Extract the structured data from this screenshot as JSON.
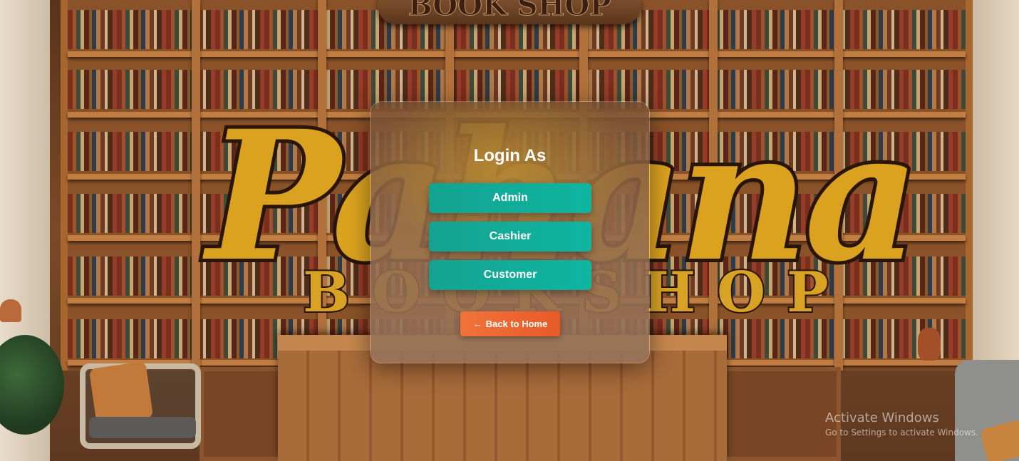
{
  "background": {
    "sign_text": "BOOK SHOP",
    "logo_word": "Pahana",
    "logo_sub": "BOOKSHOP"
  },
  "login": {
    "title": "Login As",
    "roles": [
      "Admin",
      "Cashier",
      "Customer"
    ],
    "back_label": "Back to Home",
    "back_icon": "arrow-left-icon"
  },
  "watermark": {
    "title": "Activate Windows",
    "subtitle": "Go to Settings to activate Windows."
  },
  "colors": {
    "role_button": "#0fb5a0",
    "back_button": "#e85a28",
    "title_text": "#ffffff"
  }
}
